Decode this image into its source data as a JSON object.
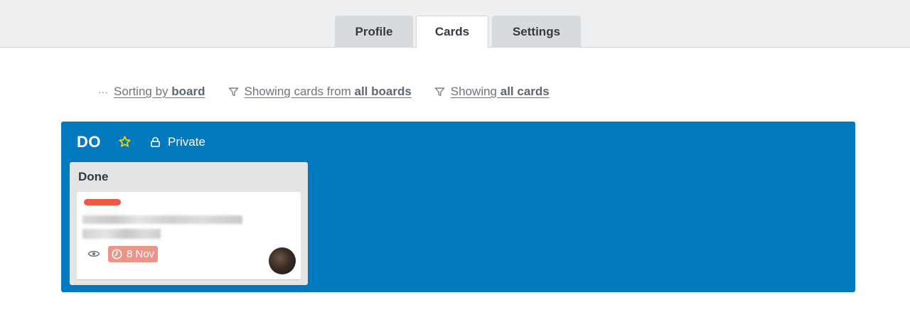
{
  "tabs": [
    {
      "label": "Profile",
      "active": false
    },
    {
      "label": "Cards",
      "active": true
    },
    {
      "label": "Settings",
      "active": false
    }
  ],
  "filters": {
    "sort": {
      "icon": "ellipsis-icon",
      "prefix": "Sorting by",
      "value": "board"
    },
    "boards": {
      "icon": "filter-icon",
      "prefix": "Showing cards from",
      "value": "all boards"
    },
    "cards": {
      "icon": "filter-icon",
      "prefix": "Showing",
      "value": "all cards"
    }
  },
  "board": {
    "title": "DO",
    "starred": true,
    "privacy": "Private",
    "background_color": "#0079bf",
    "lists": [
      {
        "title": "Done",
        "cards": [
          {
            "label_color": "#eb5a46",
            "watching": true,
            "due_date": "8 Nov",
            "due_color": "#ec9488"
          }
        ]
      }
    ]
  },
  "colors": {
    "accent_star": "#f2d600",
    "topbar": "#eeeff1"
  }
}
